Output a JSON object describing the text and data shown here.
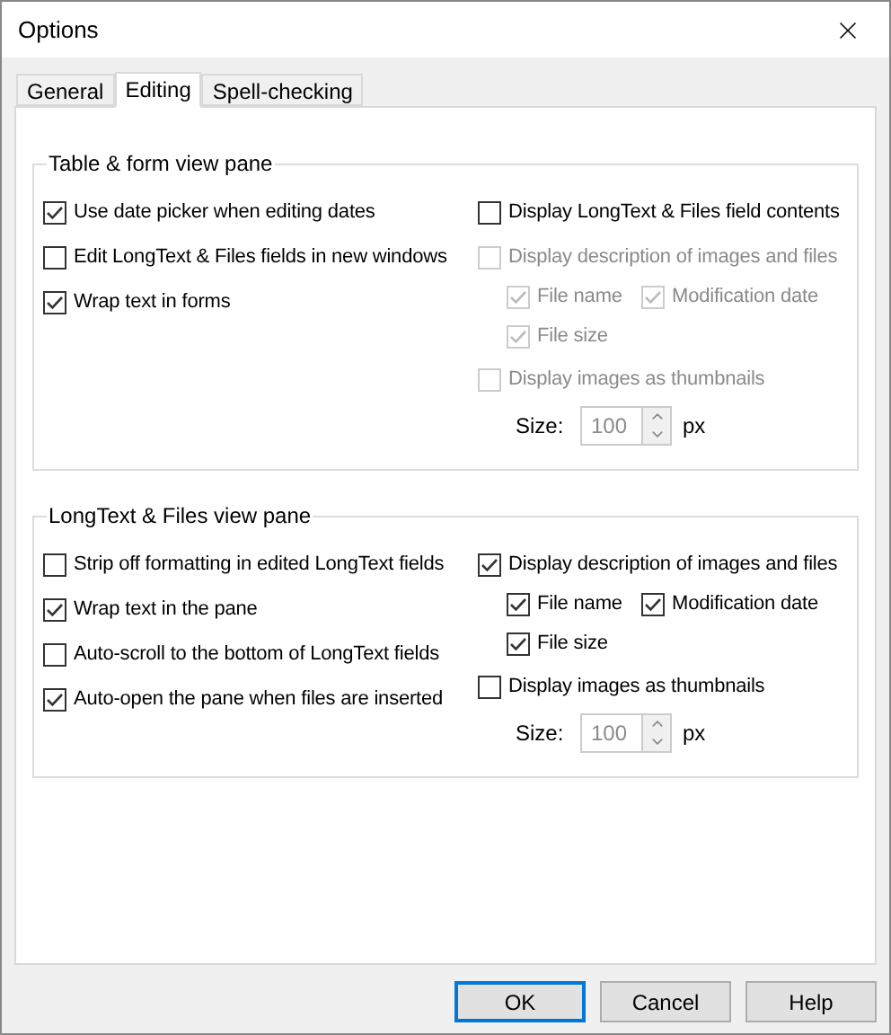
{
  "window": {
    "title": "Options"
  },
  "tabs": [
    {
      "label": "General",
      "selected": false
    },
    {
      "label": "Editing",
      "selected": true
    },
    {
      "label": "Spell-checking",
      "selected": false
    }
  ],
  "groups": [
    {
      "title": "Table & form view pane",
      "left": [
        {
          "label": "Use date picker when editing dates",
          "checked": true
        },
        {
          "label": "Edit LongText & Files fields in new windows",
          "checked": false
        },
        {
          "label": "Wrap text in forms",
          "checked": true
        }
      ],
      "right": [
        {
          "kind": "checkbox",
          "label": "Display LongText & Files field contents",
          "checked": false,
          "disabled": false
        },
        {
          "kind": "checkbox",
          "label": "Display description of images and files",
          "checked": false,
          "disabled": true,
          "children": [
            {
              "label": "File name",
              "checked": true,
              "disabled": true
            },
            {
              "label": "Modification date",
              "checked": true,
              "disabled": true
            },
            {
              "label": "File size",
              "checked": true,
              "disabled": true
            }
          ]
        },
        {
          "kind": "checkbox",
          "label": "Display images as thumbnails",
          "checked": false,
          "disabled": true
        },
        {
          "kind": "spin",
          "label": "Size:",
          "value": "100",
          "unit": "px"
        }
      ]
    },
    {
      "title": "LongText & Files view pane",
      "left": [
        {
          "label": "Strip off formatting in edited LongText fields",
          "checked": false
        },
        {
          "label": "Wrap text in the pane",
          "checked": true
        },
        {
          "label": "Auto-scroll to the bottom of LongText fields",
          "checked": false
        },
        {
          "label": "Auto-open the pane when files are inserted",
          "checked": true
        }
      ],
      "right": [
        {
          "kind": "checkbox",
          "label": "Display description of images and files",
          "checked": true,
          "disabled": false,
          "children": [
            {
              "label": "File name",
              "checked": true,
              "disabled": false
            },
            {
              "label": "Modification date",
              "checked": true,
              "disabled": false
            },
            {
              "label": "File size",
              "checked": true,
              "disabled": false
            }
          ]
        },
        {
          "kind": "checkbox",
          "label": "Display images as thumbnails",
          "checked": false,
          "disabled": false
        },
        {
          "kind": "spin",
          "label": "Size:",
          "value": "100",
          "unit": "px"
        }
      ]
    }
  ],
  "buttons": [
    {
      "label": "OK",
      "default": true
    },
    {
      "label": "Cancel",
      "default": false
    },
    {
      "label": "Help",
      "default": false
    }
  ]
}
